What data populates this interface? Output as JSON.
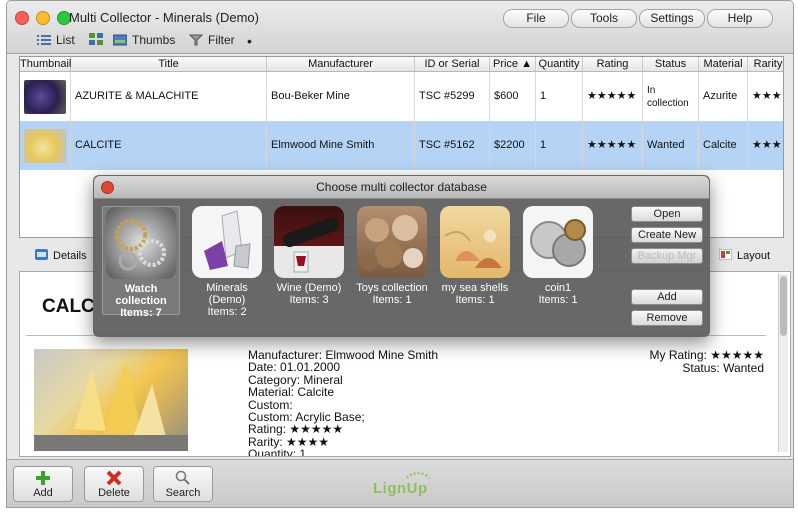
{
  "window": {
    "title": "Multi Collector - Minerals (Demo)"
  },
  "menu": {
    "file": "File",
    "tools": "Tools",
    "settings": "Settings",
    "help": "Help"
  },
  "toolbar": {
    "list": "List",
    "thumbs": "Thumbs",
    "filter": "Filter",
    "dot": "•"
  },
  "table": {
    "headers": [
      "Thumbnail",
      "Title",
      "Manufacturer",
      "ID or Serial",
      "Price ▲",
      "Quantity",
      "Rating",
      "Status",
      "Material",
      "Rarity"
    ],
    "rows": [
      {
        "title": "AZURITE & MALACHITE",
        "manufacturer": "Bou-Beker Mine",
        "id": "TSC #5299",
        "price": "$600",
        "quantity": "1",
        "rating": "★★★★★",
        "status": "In collection",
        "material": "Azurite",
        "rarity": "★★★"
      },
      {
        "title": "CALCITE",
        "manufacturer": "Elmwood Mine Smith",
        "id": "TSC #5162",
        "price": "$2200",
        "quantity": "1",
        "rating": "★★★★★",
        "status": "Wanted",
        "material": "Calcite",
        "rarity": "★★★"
      }
    ]
  },
  "tabs": {
    "details": "Details",
    "layout": "Layout"
  },
  "detail": {
    "heading": "CALC",
    "lines": [
      "Manufacturer: Elmwood Mine Smith",
      "Date: 01.01.2000",
      "Category: Mineral",
      "Material: Calcite",
      "Custom:",
      "Custom: Acrylic Base;",
      "Rating: ★★★★★",
      "Rarity: ★★★★",
      "Quantity: 1"
    ],
    "my_rating": "My Rating: ★★★★★",
    "status": "Status: Wanted"
  },
  "bottom": {
    "add": "Add",
    "delete": "Delete",
    "search": "Search",
    "logo": "LignUp"
  },
  "dialog": {
    "title": "Choose multi collector database",
    "databases": [
      {
        "name": "Watch collection",
        "items": "Items: 7",
        "icon": "watch-gears-icon"
      },
      {
        "name": "Minerals (Demo)",
        "items": "Items: 2",
        "icon": "mineral-crystal-icon"
      },
      {
        "name": "Wine (Demo)",
        "items": "Items: 3",
        "icon": "wine-bottle-icon"
      },
      {
        "name": "Toys collection",
        "items": "Items: 1",
        "icon": "teddy-bears-icon"
      },
      {
        "name": "my sea shells",
        "items": "Items: 1",
        "icon": "sea-shells-icon"
      },
      {
        "name": "coin1",
        "items": "Items: 1",
        "icon": "coins-icon"
      }
    ],
    "buttons": {
      "open": "Open",
      "create_new": "Create New",
      "backup": "Backup Mgr",
      "add": "Add",
      "remove": "Remove"
    }
  },
  "colors": {
    "selected_row": "#b5d4f5",
    "accent_green": "#7bbf2a",
    "close_red": "#e0453a"
  }
}
